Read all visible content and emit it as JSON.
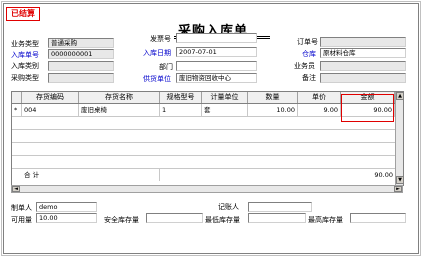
{
  "stamp": "已结算",
  "title": "采购入库单",
  "header": {
    "business_type_label": "业务类型",
    "business_type_value": "普通采购",
    "invoice_no_label": "发票号",
    "invoice_no_value": "",
    "order_no_label": "订单号",
    "order_no_value": "",
    "inbound_no_label": "入库单号",
    "inbound_no_value": "0000000001",
    "inbound_date_label": "入库日期",
    "inbound_date_value": "2007-07-01",
    "warehouse_label": "仓库",
    "warehouse_value": "原材料仓库",
    "inbound_category_label": "入库类别",
    "inbound_category_value": "",
    "department_label": "部门",
    "department_value": "",
    "salesperson_label": "业务员",
    "salesperson_value": "",
    "purchase_type_label": "采购类型",
    "purchase_type_value": "",
    "supplier_label": "供货单位",
    "supplier_value": "废旧物资回收中心",
    "remark_label": "备注",
    "remark_value": ""
  },
  "table": {
    "columns": [
      "存货编码",
      "存货名称",
      "规格型号",
      "计量单位",
      "数量",
      "单价",
      "金额"
    ],
    "rows": [
      {
        "marker": "*",
        "code": "004",
        "name": "废旧桌椅",
        "spec": "1",
        "unit": "套",
        "qty": "10.00",
        "price": "9.00",
        "amount": "90.00"
      }
    ],
    "total_label": "合    计",
    "total_amount": "90.00"
  },
  "footer": {
    "maker_label": "制单人",
    "maker_value": "demo",
    "bookkeeper_label": "记账人",
    "bookkeeper_value": "",
    "available_label": "可用量",
    "available_value": "10.00",
    "safety_stock_label": "安全库存量",
    "safety_stock_value": "",
    "min_stock_label": "最低库存量",
    "min_stock_value": "",
    "max_stock_label": "最高库存量",
    "max_stock_value": ""
  }
}
